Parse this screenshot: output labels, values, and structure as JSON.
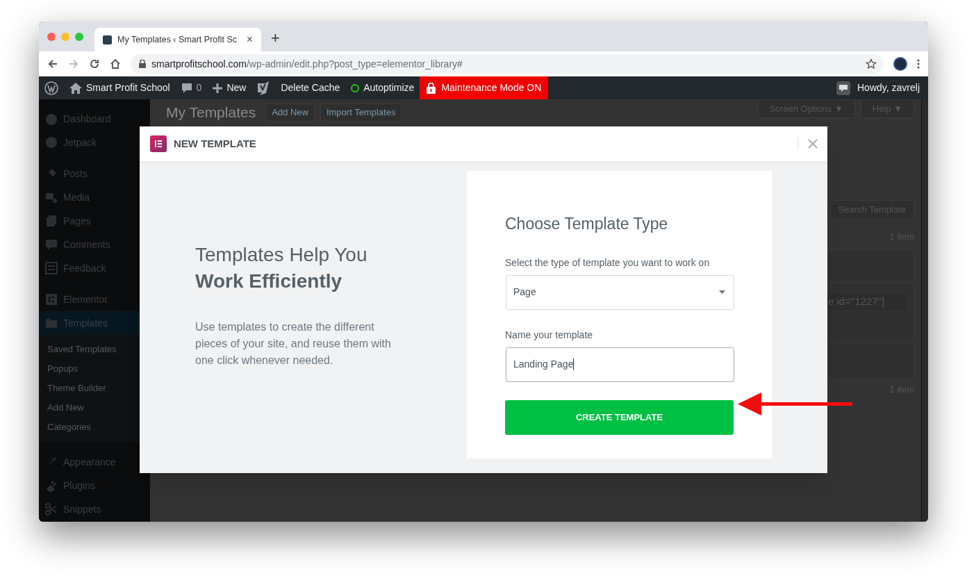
{
  "browser": {
    "tabs": [
      {
        "title": "My Templates ‹ Smart Profit Sc",
        "close": "×",
        "selected": true
      }
    ],
    "new_tab": "+",
    "url": {
      "domain": "smartprofitschool.com",
      "path": "/wp-admin/edit.php?post_type=elementor_library#"
    }
  },
  "admin_bar": {
    "items": [
      {
        "kind": "wp"
      },
      {
        "kind": "site",
        "label": "Smart Profit School"
      },
      {
        "kind": "comments",
        "label": "0"
      },
      {
        "kind": "new",
        "label": "New"
      },
      {
        "kind": "yoast"
      },
      {
        "kind": "text",
        "label": "Delete Cache"
      },
      {
        "kind": "status",
        "label": "Autoptimize",
        "color": "#22c40f"
      },
      {
        "kind": "alert",
        "label": "Maintenance Mode ON"
      }
    ],
    "greeting": "Howdy, zavrelj"
  },
  "sidebar": {
    "groups": [
      [
        {
          "label": "Dashboard",
          "selected": false
        },
        {
          "label": "Jetpack",
          "selected": false
        }
      ],
      [
        {
          "label": "Posts",
          "selected": false
        },
        {
          "label": "Media",
          "selected": false
        },
        {
          "label": "Pages",
          "selected": false
        },
        {
          "label": "Comments",
          "selected": false
        },
        {
          "label": "Feedback",
          "selected": false
        }
      ],
      [
        {
          "label": "Elementor",
          "selected": false
        },
        {
          "label": "Templates",
          "selected": true,
          "children": [
            {
              "label": "Saved Templates"
            },
            {
              "label": "Popups"
            },
            {
              "label": "Theme Builder"
            },
            {
              "label": "Add New"
            },
            {
              "label": "Categories"
            }
          ]
        }
      ],
      [
        {
          "label": "Appearance",
          "selected": false
        },
        {
          "label": "Plugins",
          "selected": false
        },
        {
          "label": "Snippets",
          "selected": false
        }
      ]
    ]
  },
  "page": {
    "title": "My Templates",
    "buttons": [
      "Add New",
      "Import Templates"
    ],
    "screen_options": "Screen Options ▼",
    "help": "Help ▼",
    "search_button": "Search Template",
    "item_counts": [
      "1 item",
      "1 item"
    ],
    "shortcode": "e id=\"1227\"]"
  },
  "modal": {
    "title": "NEW TEMPLATE",
    "heading": "Templates Help You\n**Work Efficiently**",
    "description": "Use templates to create the different pieces of your site, and reuse them with one click whenever needed.",
    "card": {
      "title": "Choose Template Type",
      "type_label": "Select the type of template you want to work on",
      "type_value": "Page",
      "name_label": "Name your template",
      "name_value": "Landing Page",
      "button": "CREATE TEMPLATE"
    }
  }
}
